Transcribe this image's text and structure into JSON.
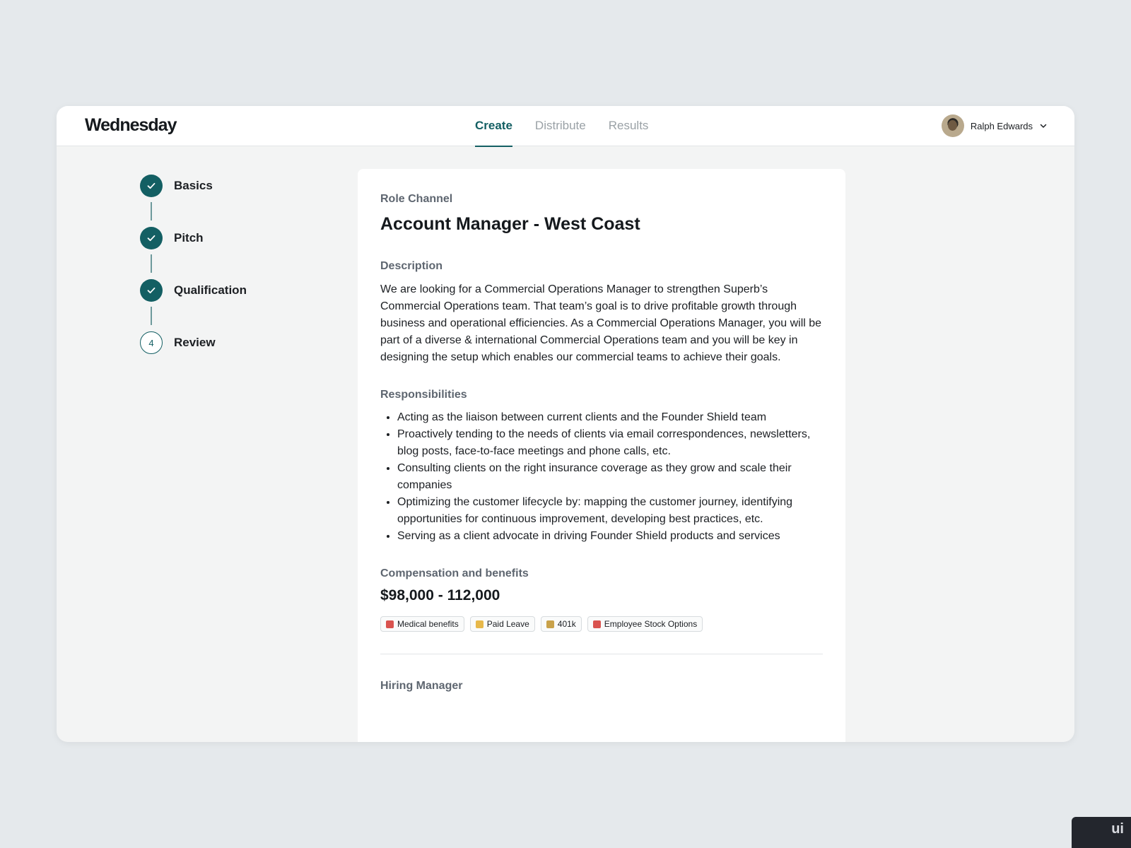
{
  "app": {
    "logo": "Wednesday"
  },
  "nav": {
    "tabs": [
      {
        "label": "Create",
        "active": true
      },
      {
        "label": "Distribute",
        "active": false
      },
      {
        "label": "Results",
        "active": false
      }
    ]
  },
  "user": {
    "name": "Ralph Edwards"
  },
  "steps": [
    {
      "label": "Basics",
      "status": "complete"
    },
    {
      "label": "Pitch",
      "status": "complete"
    },
    {
      "label": "Qualification",
      "status": "complete"
    },
    {
      "label": "Review",
      "status": "current",
      "number": "4"
    }
  ],
  "card": {
    "role_channel_label": "Role Channel",
    "role_title": "Account Manager - West Coast",
    "description_label": "Description",
    "description": "We are looking for a Commercial Operations Manager to strengthen Superb’s Commercial Operations team. That team’s goal is to drive profitable growth through business and operational efficiencies. As a Commercial Operations Manager, you will be part of a diverse & international Commercial Operations team and you will be key in designing the setup which enables our commercial teams to achieve their goals.",
    "responsibilities_label": "Responsibilities",
    "responsibilities": [
      "Acting as the liaison between current clients and the Founder Shield team",
      "Proactively tending to the needs of clients via email correspondences, newsletters, blog posts, face-to-face meetings and phone calls, etc.",
      "Consulting clients on the right insurance coverage as they grow and scale their companies",
      "Optimizing the customer lifecycle by: mapping the customer journey, identifying opportunities for continuous improvement, developing best practices, etc.",
      "Serving as a client advocate in driving Founder Shield products and services"
    ],
    "compensation_label": "Compensation and benefits",
    "salary": "$98,000 - 112,000",
    "benefits": [
      {
        "label": "Medical benefits",
        "icon": "hospital-icon",
        "color": "#d9534f"
      },
      {
        "label": "Paid Leave",
        "icon": "beach-icon",
        "color": "#e7b84a"
      },
      {
        "label": "401k",
        "icon": "bank-icon",
        "color": "#c9a24a"
      },
      {
        "label": "Employee Stock Options",
        "icon": "chart-icon",
        "color": "#d9534f"
      }
    ],
    "hiring_manager_label": "Hiring Manager"
  },
  "colors": {
    "accent": "#135f63",
    "page_bg": "#e5e9ec"
  },
  "watermark": "ui"
}
